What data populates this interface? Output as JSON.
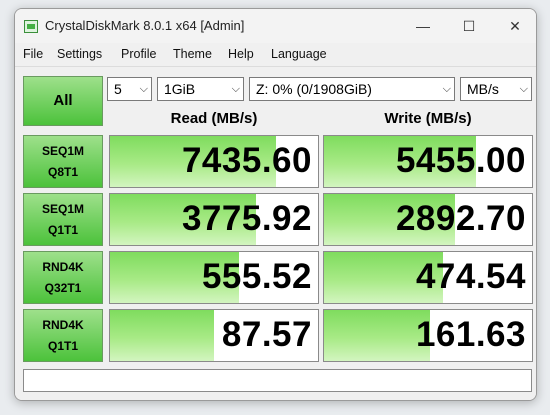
{
  "window": {
    "title": "CrystalDiskMark 8.0.1 x64 [Admin]"
  },
  "menu": [
    "File",
    "Settings",
    "Profile",
    "Theme",
    "Help",
    "Language"
  ],
  "controls": {
    "all_label": "All",
    "count_value": "5",
    "size_value": "1GiB",
    "drive_value": "Z: 0% (0/1908GiB)",
    "unit_value": "MB/s"
  },
  "headers": {
    "read": "Read (MB/s)",
    "write": "Write (MB/s)"
  },
  "rows": [
    {
      "name_line1": "SEQ1M",
      "name_line2": "Q8T1",
      "read": "7435.60",
      "write": "5455.00",
      "read_fill": 0.8,
      "write_fill": 0.73
    },
    {
      "name_line1": "SEQ1M",
      "name_line2": "Q1T1",
      "read": "3775.92",
      "write": "2892.70",
      "read_fill": 0.7,
      "write_fill": 0.63
    },
    {
      "name_line1": "RND4K",
      "name_line2": "Q32T1",
      "read": "555.52",
      "write": "474.54",
      "read_fill": 0.62,
      "write_fill": 0.57
    },
    {
      "name_line1": "RND4K",
      "name_line2": "Q1T1",
      "read": "87.57",
      "write": "161.63",
      "read_fill": 0.5,
      "write_fill": 0.51
    }
  ],
  "icons": {
    "minimize": "minimize-icon",
    "maximize": "maximize-icon",
    "close": "close-icon"
  },
  "colors": {
    "accent_green": "#4cc23b",
    "bar_green": "#7fdc5e"
  }
}
